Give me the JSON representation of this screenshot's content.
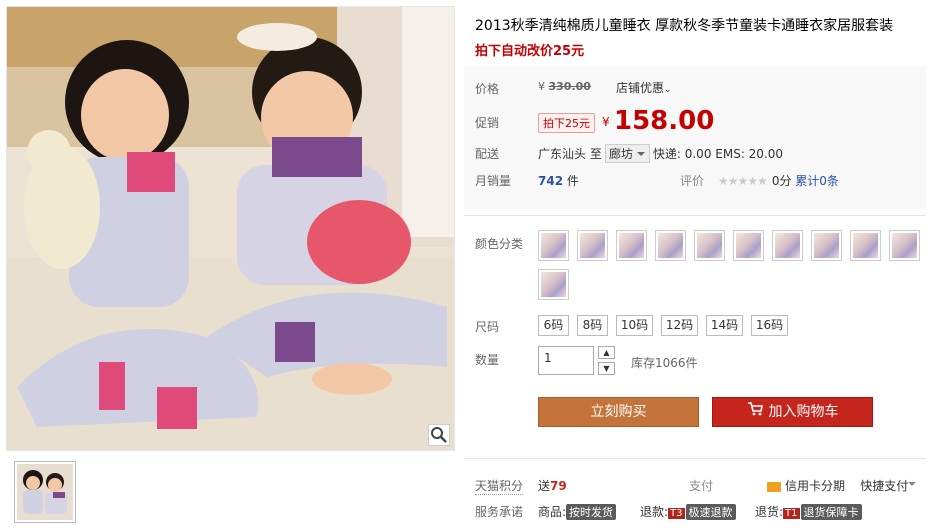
{
  "product": {
    "title": "2013秋季清纯棉质儿童睡衣 厚款秋冬季节童装卡通睡衣家居服套装",
    "promo": "拍下自动改价25元"
  },
  "price": {
    "label": "价格",
    "currency": "¥",
    "original": "330.00",
    "shop_discount": "店铺优惠",
    "promo_label": "促销",
    "promo_tag": "拍下25元",
    "current_currency": "¥",
    "current": "158.00"
  },
  "shipping": {
    "label": "配送",
    "from": "广东汕头",
    "to_word": "至",
    "to": "廊坊",
    "express": "快递: 0.00 EMS: 20.00"
  },
  "sales": {
    "label": "月销量",
    "count": "742",
    "unit": "件",
    "rating_label": "评价",
    "stars": "★★★★★",
    "score": "0分",
    "total_reviews": "累计0条"
  },
  "color": {
    "label": "颜色分类",
    "swatch_count": 11
  },
  "sizes": {
    "label": "尺码",
    "options": [
      "6码",
      "8码",
      "10码",
      "12码",
      "14码",
      "16码"
    ]
  },
  "quantity": {
    "label": "数量",
    "value": "1",
    "up": "▲",
    "down": "▼",
    "stock": "库存1066件"
  },
  "actions": {
    "buy_now": "立刻购买",
    "add_to_cart": "加入购物车"
  },
  "tmall": {
    "points_label": "天猫积分",
    "points_prefix": "送",
    "points_value": "79",
    "pay_label": "支付",
    "credit": "信用卡分期",
    "quick_pay": "快捷支付",
    "promise_label": "服务承诺",
    "goods_label": "商品:",
    "goods_badge": "按时发货",
    "refund_label": "退款:",
    "refund_code": "T3",
    "refund_badge": "极速退款",
    "return_label": "退货:",
    "return_code": "T1",
    "return_badge": "退货保障卡"
  },
  "colors": {
    "price_red": "#c40000",
    "buy_orange": "#c4743a",
    "cart_red": "#c4251c",
    "link_blue": "#2953a6"
  }
}
